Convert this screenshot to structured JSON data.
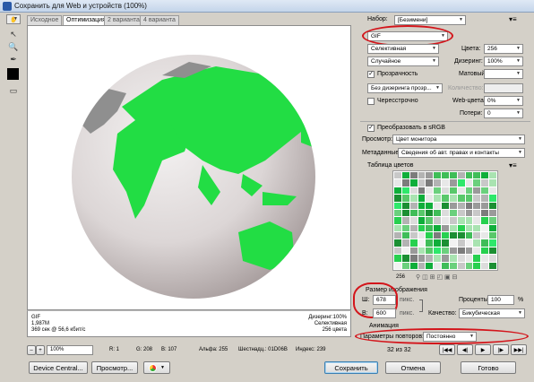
{
  "window": {
    "title": "Сохранить для Web и устройств (100%)"
  },
  "tabs": [
    "Исходное",
    "Оптимизация",
    "2 варианта",
    "4 варианта"
  ],
  "active_tab": 1,
  "info": {
    "left": [
      "GIF",
      "1,987M",
      "369 сек @ 56,6 кбит/с"
    ],
    "right": [
      "Дизеринг:100%",
      "Селективная",
      "256 цвета"
    ]
  },
  "status": {
    "zoom": "100%",
    "r": "R: 1",
    "g": "G: 208",
    "b": "B: 107",
    "alpha": "Альфа: 255",
    "hex": "Шестнадц.: 01D06B",
    "index": "Индекс: 239"
  },
  "buttons": {
    "device_central": "Device Central...",
    "preview": "Просмотр...",
    "save": "Сохранить",
    "cancel": "Отмена",
    "done": "Готово"
  },
  "settings": {
    "preset_label": "Набор:",
    "preset_value": "[Безимени]",
    "format": "GIF",
    "reduction": "Селективная",
    "colors_label": "Цвета:",
    "colors_value": "256",
    "dither_method": "Случайное",
    "dither_label": "Дизеринг:",
    "dither_value": "100%",
    "transparency_label": "Прозрачность",
    "matte_label": "Матовый:",
    "transp_dither": "Без дизеринга прозр...",
    "amount_label": "Количество:",
    "interlaced_label": "Чересстрочно",
    "websnap_label": "Web-цвета:",
    "websnap_value": "0%",
    "lossy_label": "Потери:",
    "lossy_value": "0",
    "srgb_label": "Преобразовать в sRGB",
    "preview_label": "Просмотр:",
    "preview_value": "Цвет монитора",
    "metadata_label": "Метаданные:",
    "metadata_value": "Сведения об авт. правах и контакты",
    "color_table_label": "Таблица цветов",
    "color_count": "256",
    "image_size_label": "Размер изображения",
    "width_label": "Ш:",
    "width_value": "678",
    "height_label": "В:",
    "height_value": "600",
    "unit": "пикс.",
    "percent_label": "Проценты:",
    "percent_value": "100",
    "percent_unit": "%",
    "quality_label": "Качество:",
    "quality_value": "Бикубическая",
    "animation_label": "Анимация",
    "loop_label": "Параметры повторов:",
    "loop_value": "Постоянно",
    "frame_counter": "32 из 32"
  },
  "colors": {
    "accent_red": "#d3151b",
    "globe_land_green": "#22dd44",
    "titlebar": "#c4d5ea"
  }
}
